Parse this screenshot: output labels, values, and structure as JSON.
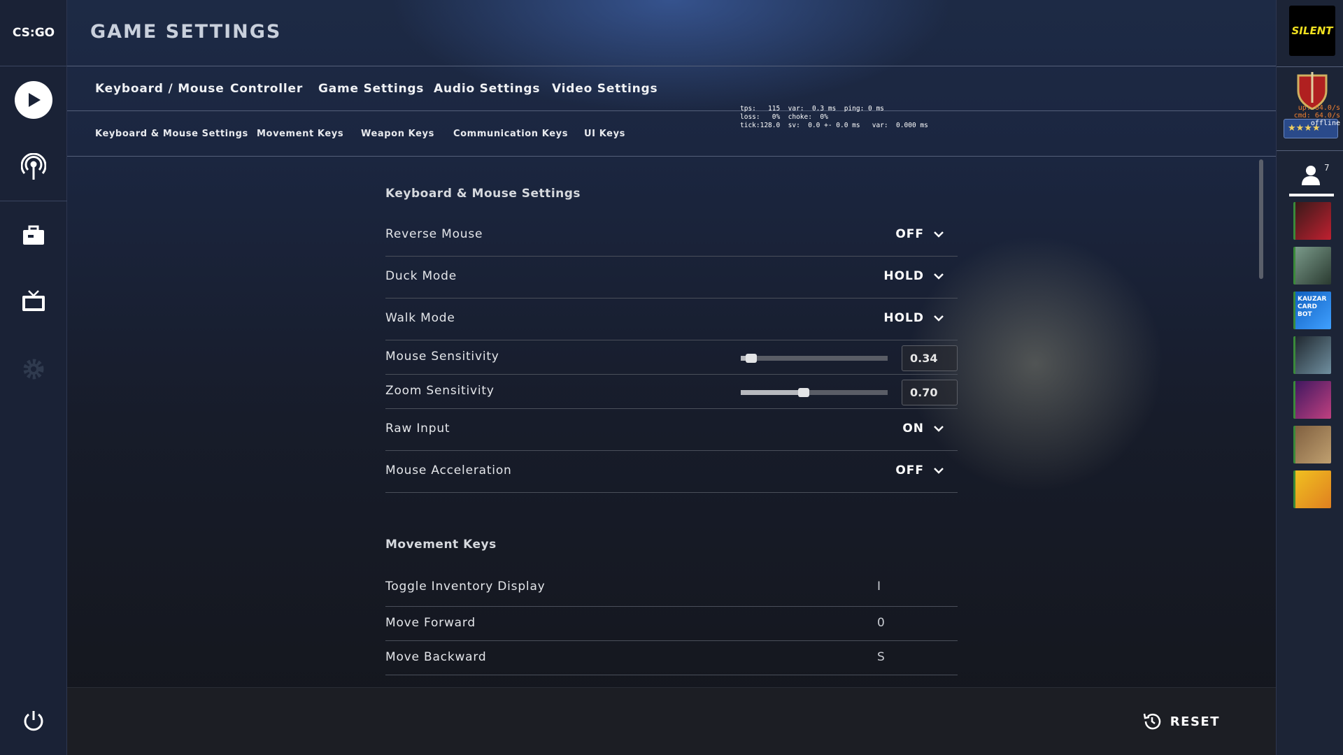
{
  "app": {
    "logo": "CS:GO",
    "title": "GAME SETTINGS"
  },
  "tabs": [
    {
      "label": "Keyboard / Mouse"
    },
    {
      "label": "Controller"
    },
    {
      "label": "Game Settings"
    },
    {
      "label": "Audio Settings"
    },
    {
      "label": "Video Settings"
    }
  ],
  "subtabs": [
    {
      "label": "Keyboard & Mouse Settings"
    },
    {
      "label": "Movement Keys"
    },
    {
      "label": "Weapon Keys"
    },
    {
      "label": "Communication Keys"
    },
    {
      "label": "UI Keys"
    }
  ],
  "netgraph": {
    "line1": "tps:   115  var:  0.3 ms  ping: 0 ms",
    "line2": "loss:   0%  choke:  0%",
    "line3": "tick:128.0  sv:  0.0 +- 0.0 ms   var:  0.000 ms"
  },
  "sections": [
    {
      "title": "Keyboard & Mouse Settings",
      "rows": [
        {
          "label": "Reverse Mouse",
          "type": "dropdown",
          "value": "OFF"
        },
        {
          "label": "Duck Mode",
          "type": "dropdown",
          "value": "HOLD"
        },
        {
          "label": "Walk Mode",
          "type": "dropdown",
          "value": "HOLD"
        },
        {
          "label": "Mouse Sensitivity",
          "type": "slider",
          "value": "0.34",
          "fraction": 0.07
        },
        {
          "label": "Zoom Sensitivity",
          "type": "slider",
          "value": "0.70",
          "fraction": 0.43
        },
        {
          "label": "Raw Input",
          "type": "dropdown",
          "value": "ON"
        },
        {
          "label": "Mouse Acceleration",
          "type": "dropdown",
          "value": "OFF"
        }
      ]
    },
    {
      "title": "Movement Keys",
      "rows": [
        {
          "label": "Toggle Inventory Display",
          "type": "key",
          "value": "I"
        },
        {
          "label": "Move Forward",
          "type": "key",
          "value": "0"
        },
        {
          "label": "Move Backward",
          "type": "key",
          "value": "S"
        }
      ]
    }
  ],
  "footer": {
    "reset_label": "RESET"
  },
  "rightbar": {
    "team_name": "SILENT",
    "netstats": {
      "up": "up: 64.0/s",
      "cmd": "cmd: 64.0/s",
      "status": "offline"
    },
    "friends_count": "7",
    "friends": [
      {
        "colors": [
          "#3a1a1a",
          "#c02030"
        ]
      },
      {
        "colors": [
          "#7a9a8a",
          "#2a3a30"
        ]
      },
      {
        "colors": [
          "#1060c0",
          "#40a0ff"
        ],
        "text": "KAUZAR CARD BOT"
      },
      {
        "colors": [
          "#202830",
          "#7090a0"
        ]
      },
      {
        "colors": [
          "#401860",
          "#c04080"
        ]
      },
      {
        "colors": [
          "#806040",
          "#c0a070"
        ]
      },
      {
        "colors": [
          "#f0c020",
          "#e08020"
        ]
      }
    ]
  },
  "colors": {
    "accent": "#ffffff",
    "netgraph_orange": "#f08030"
  }
}
